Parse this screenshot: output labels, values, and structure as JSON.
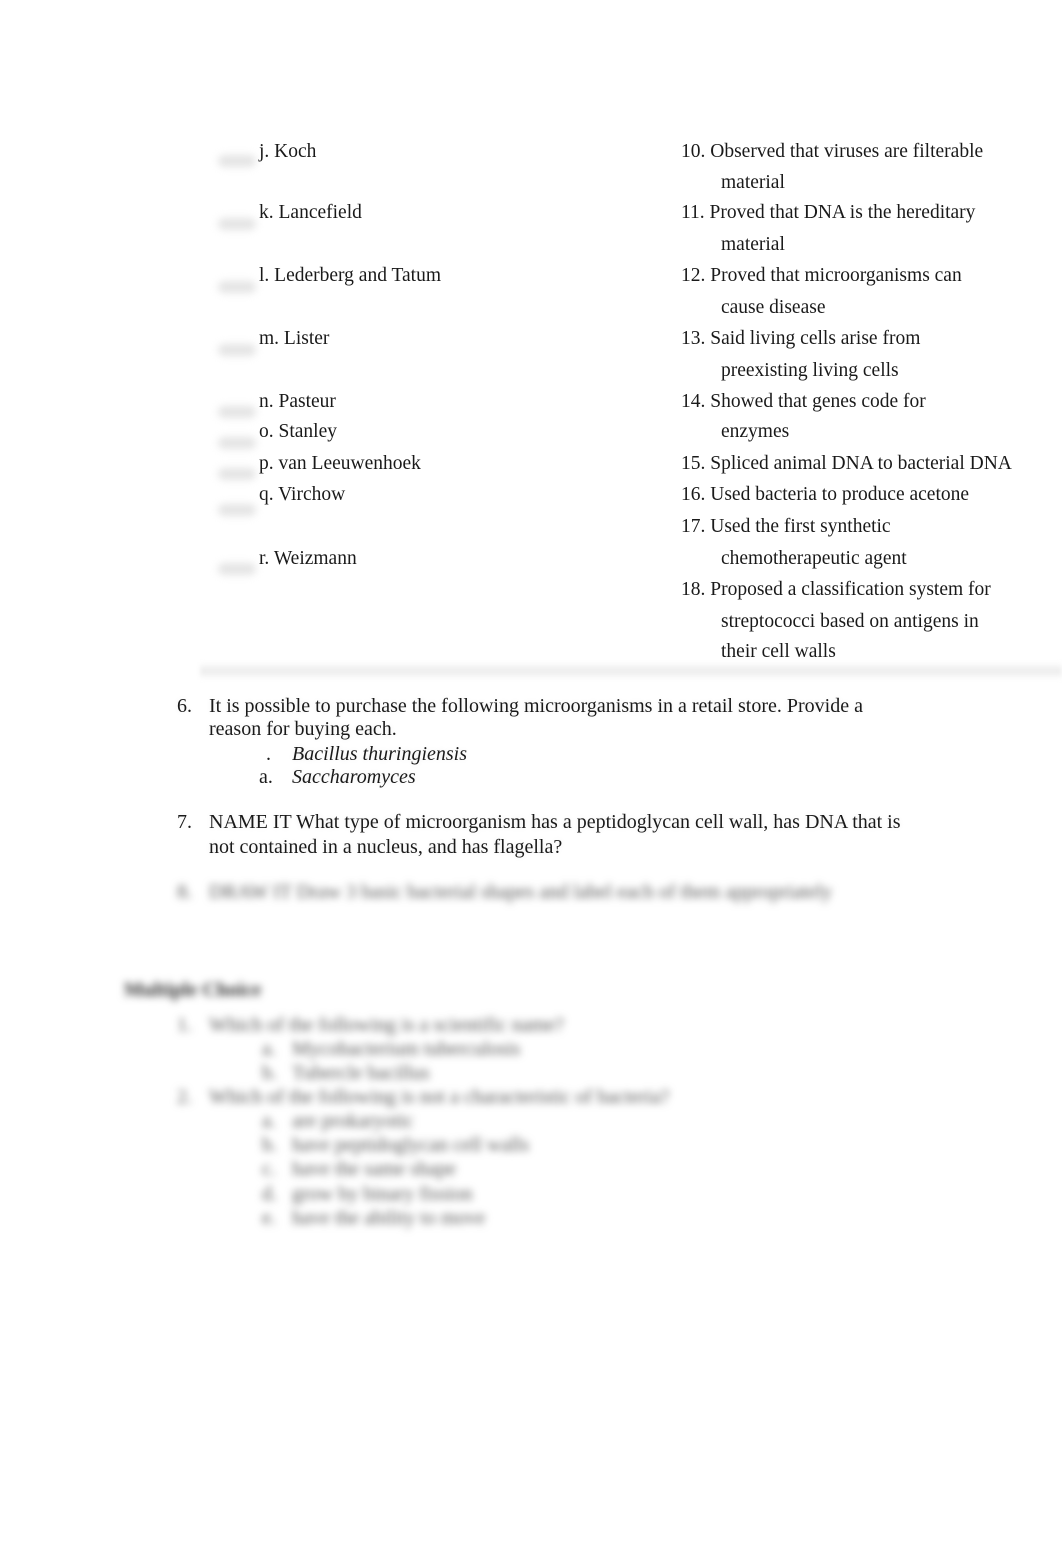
{
  "matching": {
    "names": [
      {
        "label": "j. Koch"
      },
      {
        "label": "k. Lancefield"
      },
      {
        "label": "l. Lederberg and Tatum"
      },
      {
        "label": "m. Lister"
      },
      {
        "label": "n. Pasteur"
      },
      {
        "label": "o. Stanley"
      },
      {
        "label": "p. van Leeuwenhoek"
      },
      {
        "label": "q. Virchow"
      },
      {
        "label": "r. Weizmann"
      }
    ],
    "descriptions": [
      {
        "first": "10. Observed that viruses are filterable",
        "cont": [
          "material"
        ]
      },
      {
        "first": "11. Proved that DNA is the hereditary",
        "cont": [
          "material"
        ]
      },
      {
        "first": "12. Proved that microorganisms can",
        "cont": [
          "cause disease"
        ]
      },
      {
        "first": "13. Said living cells arise from",
        "cont": [
          "preexisting living cells"
        ]
      },
      {
        "first": "14. Showed that genes code for",
        "cont": [
          "enzymes"
        ]
      },
      {
        "first": "15. Spliced animal DNA to bacterial DNA",
        "cont": []
      },
      {
        "first": "16. Used bacteria to produce acetone",
        "cont": []
      },
      {
        "first": "17. Used the first synthetic",
        "cont": [
          "chemotherapeutic agent"
        ]
      },
      {
        "first": "18. Proposed a classification system for",
        "cont": [
          "streptococci based on antigens in",
          "their cell walls"
        ]
      }
    ]
  },
  "questions": {
    "q6": {
      "number": "6.",
      "line1": "It is possible to purchase the following microorganisms in a retail store. Provide a",
      "line2": "reason for buying each.",
      "items": [
        {
          "marker": ".",
          "text": "Bacillus thuringiensis"
        },
        {
          "marker": "a.",
          "text": "Saccharomyces"
        }
      ]
    },
    "q7": {
      "number": "7.",
      "line1": "NAME IT What type of microorganism has a peptidoglycan cell wall, has DNA that is",
      "line2": "not contained in a nucleus, and has flagella?"
    },
    "q8_blurred": {
      "number": "8.",
      "text": "DRAW IT Draw 3 basic bacterial shapes and label each of them appropriately"
    }
  },
  "multiple_choice_blurred": {
    "heading": "Multiple Choice",
    "questions": [
      {
        "number": "1.",
        "text": "Which of the following is a scientific name?",
        "options": [
          {
            "marker": "a.",
            "text": "Mycobacterium tuberculosis"
          },
          {
            "marker": "b.",
            "text": "Tubercle bacillus"
          }
        ]
      },
      {
        "number": "2.",
        "text": "Which of the following is not a characteristic of bacteria?",
        "options": [
          {
            "marker": "a.",
            "text": "are prokaryotic"
          },
          {
            "marker": "b.",
            "text": "have peptidoglycan cell walls"
          },
          {
            "marker": "c.",
            "text": "have the same shape"
          },
          {
            "marker": "d.",
            "text": "grow by binary fission"
          },
          {
            "marker": "e.",
            "text": "have the ability to move"
          }
        ]
      }
    ]
  }
}
